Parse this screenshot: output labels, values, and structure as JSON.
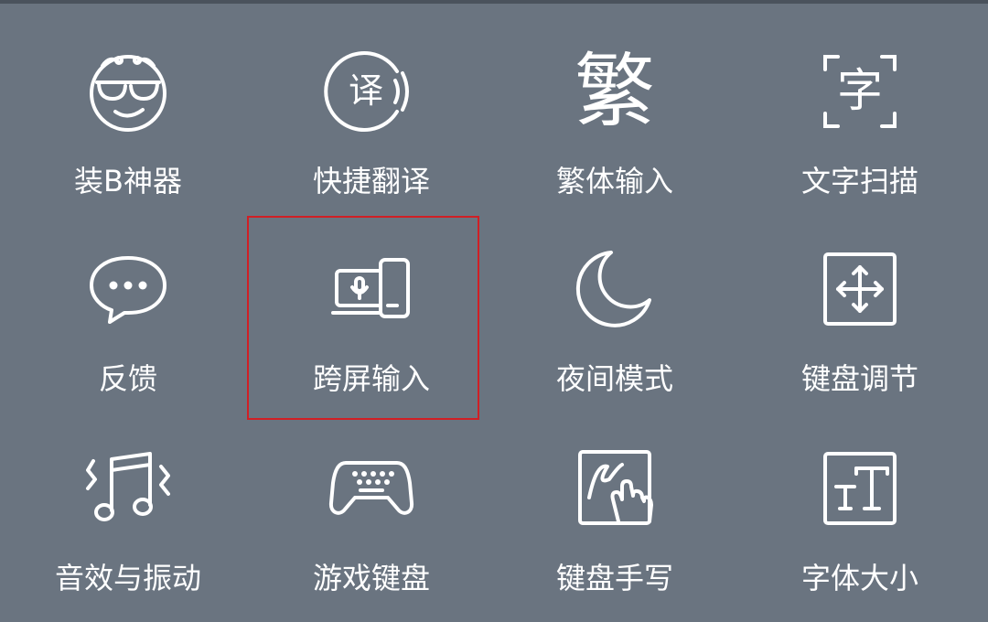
{
  "panel": {
    "items": [
      {
        "label": "装B神器",
        "icon": "sunglasses-face-icon"
      },
      {
        "label": "快捷翻译",
        "icon": "translate-voice-icon",
        "icon_text": "译"
      },
      {
        "label": "繁体输入",
        "icon": "traditional-char-icon",
        "icon_text": "繁"
      },
      {
        "label": "文字扫描",
        "icon": "scan-text-icon",
        "icon_text": "字"
      },
      {
        "label": "反馈",
        "icon": "chat-bubble-icon"
      },
      {
        "label": "跨屏输入",
        "icon": "cross-screen-icon"
      },
      {
        "label": "夜间模式",
        "icon": "moon-icon"
      },
      {
        "label": "键盘调节",
        "icon": "resize-arrows-icon"
      },
      {
        "label": "音效与振动",
        "icon": "music-vibration-icon"
      },
      {
        "label": "游戏键盘",
        "icon": "gamepad-icon"
      },
      {
        "label": "键盘手写",
        "icon": "handwriting-icon"
      },
      {
        "label": "字体大小",
        "icon": "font-size-icon",
        "icon_text": "TT"
      }
    ],
    "highlighted_item": "跨屏输入",
    "colors": {
      "background": "#6a7480",
      "foreground": "#ffffff",
      "highlight_border": "#d01f25"
    }
  }
}
